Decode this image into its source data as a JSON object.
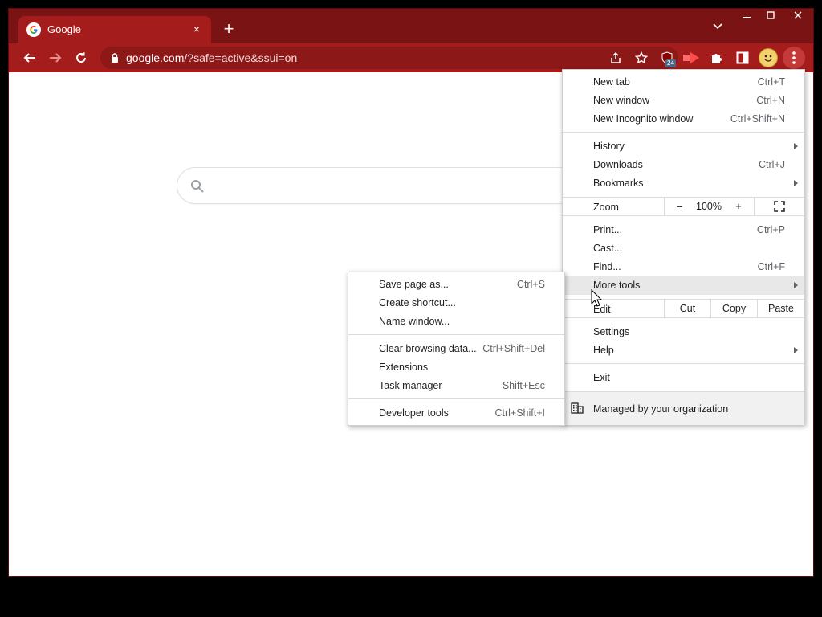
{
  "tab": {
    "title": "Google",
    "close": "×"
  },
  "newtab": "+",
  "window_controls": {
    "minimize": "—",
    "maximize": "□",
    "close": "✕"
  },
  "omnibox": {
    "host": "google.com",
    "path": "/?safe=active&ssui=on"
  },
  "extensions": {
    "ublock_badge": "24"
  },
  "main_menu": {
    "items": [
      {
        "label": "New tab",
        "shortcut": "Ctrl+T"
      },
      {
        "label": "New window",
        "shortcut": "Ctrl+N"
      },
      {
        "label": "New Incognito window",
        "shortcut": "Ctrl+Shift+N"
      },
      {
        "label": "History",
        "shortcut": ""
      },
      {
        "label": "Downloads",
        "shortcut": "Ctrl+J"
      },
      {
        "label": "Bookmarks",
        "shortcut": ""
      },
      {
        "label": "Print...",
        "shortcut": "Ctrl+P"
      },
      {
        "label": "Cast...",
        "shortcut": ""
      },
      {
        "label": "Find...",
        "shortcut": "Ctrl+F"
      },
      {
        "label": "More tools",
        "shortcut": ""
      },
      {
        "label": "Settings",
        "shortcut": ""
      },
      {
        "label": "Help",
        "shortcut": ""
      },
      {
        "label": "Exit",
        "shortcut": ""
      }
    ],
    "zoom": {
      "label": "Zoom",
      "minus": "–",
      "value": "100%",
      "plus": "+"
    },
    "edit": {
      "label": "Edit",
      "cut": "Cut",
      "copy": "Copy",
      "paste": "Paste"
    },
    "managed": "Managed by your organization"
  },
  "sub_menu": {
    "items": [
      {
        "label": "Save page as...",
        "shortcut": "Ctrl+S"
      },
      {
        "label": "Create shortcut...",
        "shortcut": ""
      },
      {
        "label": "Name window...",
        "shortcut": ""
      },
      {
        "label": "Clear browsing data...",
        "shortcut": "Ctrl+Shift+Del"
      },
      {
        "label": "Extensions",
        "shortcut": ""
      },
      {
        "label": "Task manager",
        "shortcut": "Shift+Esc"
      },
      {
        "label": "Developer tools",
        "shortcut": "Ctrl+Shift+I"
      }
    ]
  },
  "colors": {
    "frame": "#7a1414",
    "toolbar": "#a51c1c",
    "menu_bg": "#ffffff",
    "highlight": "#e8e8e8"
  }
}
